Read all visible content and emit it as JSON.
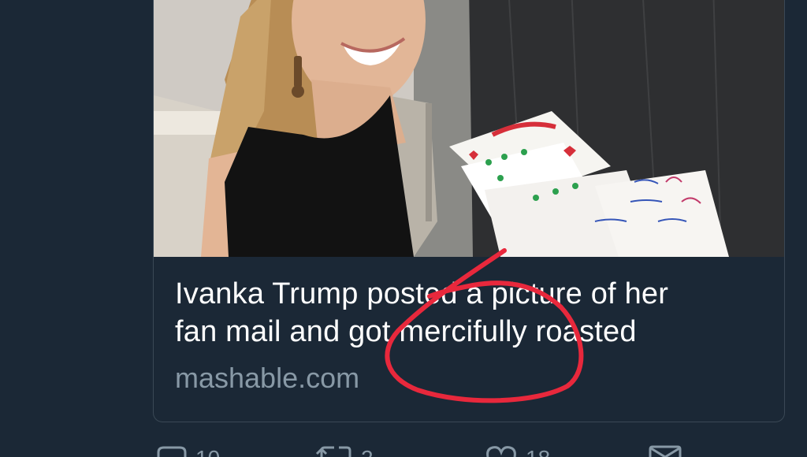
{
  "card": {
    "title_line1": "Ivanka Trump posted a picture of her",
    "title_line2": "fan mail and got mercifully roasted",
    "domain": "mashable.com",
    "image_icon": "photo-thumbnail"
  },
  "annotation": {
    "color": "#e8283c",
    "shape": "red-hand-drawn-circle"
  },
  "actions": {
    "reply_icon": "speech-bubble-icon",
    "reply_count": "10",
    "retweet_icon": "retweet-arrows-icon",
    "retweet_count": "2",
    "like_icon": "heart-icon",
    "like_count": "18",
    "dm_icon": "envelope-icon"
  },
  "colors": {
    "background": "#1b2836",
    "card_border": "#3a4855",
    "title": "#ffffff",
    "domain": "#8899a6"
  }
}
